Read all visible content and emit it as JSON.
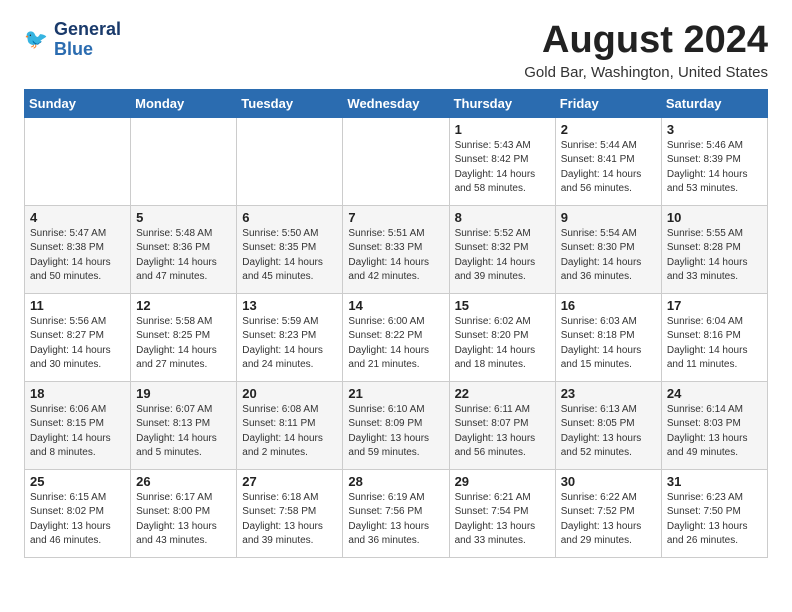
{
  "logo": {
    "line1": "General",
    "line2": "Blue"
  },
  "title": "August 2024",
  "subtitle": "Gold Bar, Washington, United States",
  "weekdays": [
    "Sunday",
    "Monday",
    "Tuesday",
    "Wednesday",
    "Thursday",
    "Friday",
    "Saturday"
  ],
  "weeks": [
    [
      {
        "day": "",
        "info": ""
      },
      {
        "day": "",
        "info": ""
      },
      {
        "day": "",
        "info": ""
      },
      {
        "day": "",
        "info": ""
      },
      {
        "day": "1",
        "info": "Sunrise: 5:43 AM\nSunset: 8:42 PM\nDaylight: 14 hours\nand 58 minutes."
      },
      {
        "day": "2",
        "info": "Sunrise: 5:44 AM\nSunset: 8:41 PM\nDaylight: 14 hours\nand 56 minutes."
      },
      {
        "day": "3",
        "info": "Sunrise: 5:46 AM\nSunset: 8:39 PM\nDaylight: 14 hours\nand 53 minutes."
      }
    ],
    [
      {
        "day": "4",
        "info": "Sunrise: 5:47 AM\nSunset: 8:38 PM\nDaylight: 14 hours\nand 50 minutes."
      },
      {
        "day": "5",
        "info": "Sunrise: 5:48 AM\nSunset: 8:36 PM\nDaylight: 14 hours\nand 47 minutes."
      },
      {
        "day": "6",
        "info": "Sunrise: 5:50 AM\nSunset: 8:35 PM\nDaylight: 14 hours\nand 45 minutes."
      },
      {
        "day": "7",
        "info": "Sunrise: 5:51 AM\nSunset: 8:33 PM\nDaylight: 14 hours\nand 42 minutes."
      },
      {
        "day": "8",
        "info": "Sunrise: 5:52 AM\nSunset: 8:32 PM\nDaylight: 14 hours\nand 39 minutes."
      },
      {
        "day": "9",
        "info": "Sunrise: 5:54 AM\nSunset: 8:30 PM\nDaylight: 14 hours\nand 36 minutes."
      },
      {
        "day": "10",
        "info": "Sunrise: 5:55 AM\nSunset: 8:28 PM\nDaylight: 14 hours\nand 33 minutes."
      }
    ],
    [
      {
        "day": "11",
        "info": "Sunrise: 5:56 AM\nSunset: 8:27 PM\nDaylight: 14 hours\nand 30 minutes."
      },
      {
        "day": "12",
        "info": "Sunrise: 5:58 AM\nSunset: 8:25 PM\nDaylight: 14 hours\nand 27 minutes."
      },
      {
        "day": "13",
        "info": "Sunrise: 5:59 AM\nSunset: 8:23 PM\nDaylight: 14 hours\nand 24 minutes."
      },
      {
        "day": "14",
        "info": "Sunrise: 6:00 AM\nSunset: 8:22 PM\nDaylight: 14 hours\nand 21 minutes."
      },
      {
        "day": "15",
        "info": "Sunrise: 6:02 AM\nSunset: 8:20 PM\nDaylight: 14 hours\nand 18 minutes."
      },
      {
        "day": "16",
        "info": "Sunrise: 6:03 AM\nSunset: 8:18 PM\nDaylight: 14 hours\nand 15 minutes."
      },
      {
        "day": "17",
        "info": "Sunrise: 6:04 AM\nSunset: 8:16 PM\nDaylight: 14 hours\nand 11 minutes."
      }
    ],
    [
      {
        "day": "18",
        "info": "Sunrise: 6:06 AM\nSunset: 8:15 PM\nDaylight: 14 hours\nand 8 minutes."
      },
      {
        "day": "19",
        "info": "Sunrise: 6:07 AM\nSunset: 8:13 PM\nDaylight: 14 hours\nand 5 minutes."
      },
      {
        "day": "20",
        "info": "Sunrise: 6:08 AM\nSunset: 8:11 PM\nDaylight: 14 hours\nand 2 minutes."
      },
      {
        "day": "21",
        "info": "Sunrise: 6:10 AM\nSunset: 8:09 PM\nDaylight: 13 hours\nand 59 minutes."
      },
      {
        "day": "22",
        "info": "Sunrise: 6:11 AM\nSunset: 8:07 PM\nDaylight: 13 hours\nand 56 minutes."
      },
      {
        "day": "23",
        "info": "Sunrise: 6:13 AM\nSunset: 8:05 PM\nDaylight: 13 hours\nand 52 minutes."
      },
      {
        "day": "24",
        "info": "Sunrise: 6:14 AM\nSunset: 8:03 PM\nDaylight: 13 hours\nand 49 minutes."
      }
    ],
    [
      {
        "day": "25",
        "info": "Sunrise: 6:15 AM\nSunset: 8:02 PM\nDaylight: 13 hours\nand 46 minutes."
      },
      {
        "day": "26",
        "info": "Sunrise: 6:17 AM\nSunset: 8:00 PM\nDaylight: 13 hours\nand 43 minutes."
      },
      {
        "day": "27",
        "info": "Sunrise: 6:18 AM\nSunset: 7:58 PM\nDaylight: 13 hours\nand 39 minutes."
      },
      {
        "day": "28",
        "info": "Sunrise: 6:19 AM\nSunset: 7:56 PM\nDaylight: 13 hours\nand 36 minutes."
      },
      {
        "day": "29",
        "info": "Sunrise: 6:21 AM\nSunset: 7:54 PM\nDaylight: 13 hours\nand 33 minutes."
      },
      {
        "day": "30",
        "info": "Sunrise: 6:22 AM\nSunset: 7:52 PM\nDaylight: 13 hours\nand 29 minutes."
      },
      {
        "day": "31",
        "info": "Sunrise: 6:23 AM\nSunset: 7:50 PM\nDaylight: 13 hours\nand 26 minutes."
      }
    ]
  ]
}
